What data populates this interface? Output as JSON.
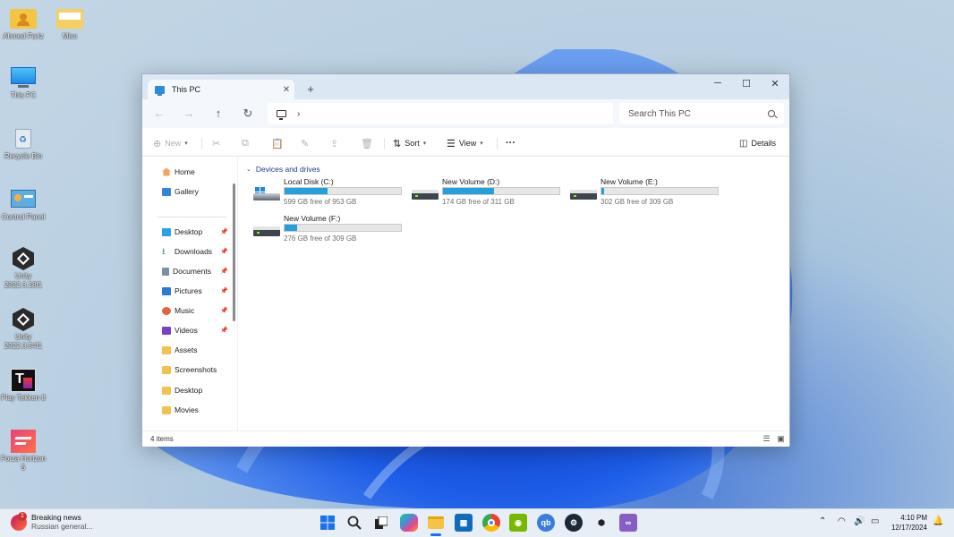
{
  "desktop": {
    "icons": [
      {
        "label": "Ahmed Fariz",
        "icon": "user-folder-icon"
      },
      {
        "label": "Misc",
        "icon": "folder-icon"
      },
      {
        "label": "This PC",
        "icon": "monitor-icon"
      },
      {
        "label": "Recycle Bin",
        "icon": "recycle-bin-icon"
      },
      {
        "label": "Control Panel",
        "icon": "control-panel-icon"
      },
      {
        "label": "Unity 2022.3.18f1",
        "icon": "unity-icon"
      },
      {
        "label": "Unity 2022.3.54f1",
        "icon": "unity-icon"
      },
      {
        "label": "Play Tekken 8",
        "icon": "tekken-icon"
      },
      {
        "label": "Forza Horizon 5",
        "icon": "forza-icon"
      }
    ]
  },
  "window": {
    "tab_title": "This PC",
    "search_placeholder": "Search This PC",
    "address_chevron": "›",
    "commands": {
      "new": "New",
      "sort": "Sort",
      "view": "View",
      "details": "Details",
      "more": "···"
    },
    "nav": {
      "home": "Home",
      "gallery": "Gallery",
      "desktop": "Desktop",
      "downloads": "Downloads",
      "documents": "Documents",
      "pictures": "Pictures",
      "music": "Music",
      "videos": "Videos",
      "assets": "Assets",
      "screenshots": "Screenshots",
      "desktop2": "Desktop",
      "movies": "Movies"
    },
    "group_title": "Devices and drives",
    "drives": [
      {
        "name": "Local Disk (C:)",
        "free": "599 GB free of 953 GB",
        "used_fraction": 0.37
      },
      {
        "name": "New Volume (D:)",
        "free": "174 GB free of 311 GB",
        "used_fraction": 0.44
      },
      {
        "name": "New Volume (E:)",
        "free": "302 GB free of 309 GB",
        "used_fraction": 0.02
      },
      {
        "name": "New Volume (F:)",
        "free": "276 GB free of 309 GB",
        "used_fraction": 0.11
      }
    ],
    "status": "4 items"
  },
  "taskbar": {
    "news_title": "Breaking news",
    "news_sub": "Russian general...",
    "news_badge": "1",
    "time": "4:10 PM",
    "date": "12/17/2024",
    "accent": "#1a73e8"
  }
}
